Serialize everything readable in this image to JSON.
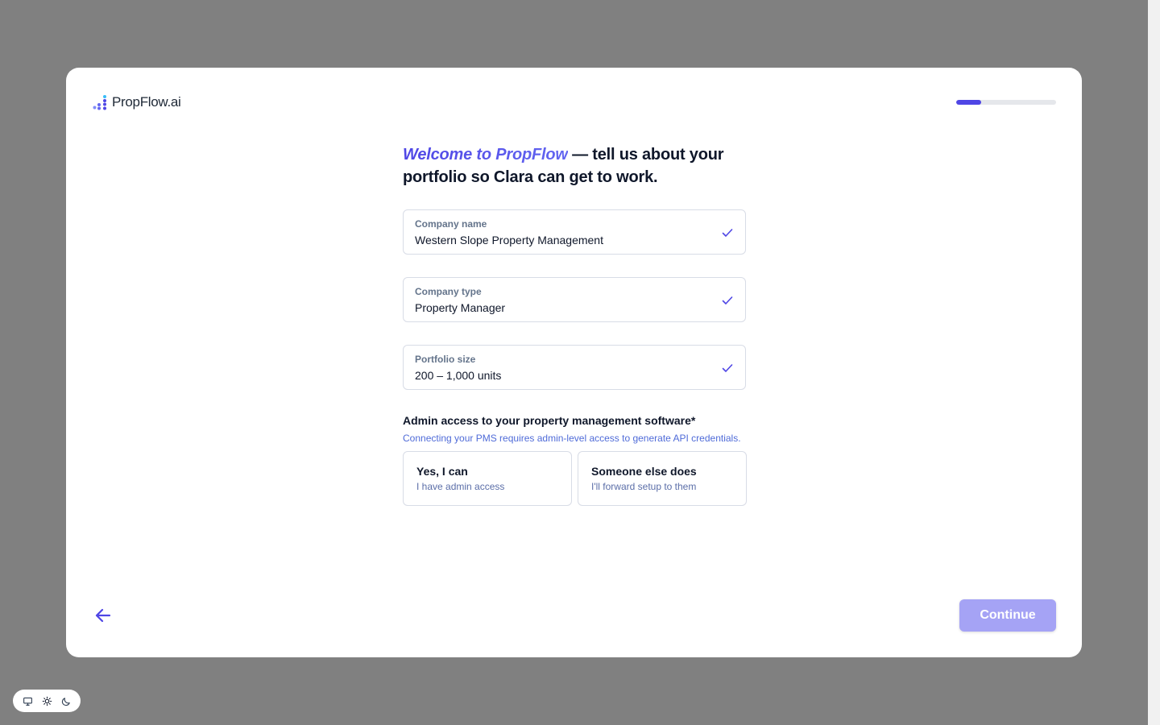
{
  "brand": {
    "name": "PropFlow.ai"
  },
  "progress": {
    "value_percent": 25
  },
  "headline": {
    "accent": "Welcome to PropFlow",
    "rest": " — tell us about your portfolio so Clara can get to work."
  },
  "fields": [
    {
      "label": "Company name",
      "value": "Western Slope Property Management"
    },
    {
      "label": "Company type",
      "value": "Property Manager"
    },
    {
      "label": "Portfolio size",
      "value": "200 – 1,000 units"
    }
  ],
  "admin_access": {
    "question": "Admin access to your property management software*",
    "help": "Connecting your PMS requires admin-level access to generate API credentials.",
    "options": [
      {
        "title": "Yes, I can",
        "subtitle": "I have admin access"
      },
      {
        "title": "Someone else does",
        "subtitle": "I'll forward setup to them"
      }
    ]
  },
  "footer": {
    "continue_label": "Continue"
  },
  "icons": {
    "check": "check-icon",
    "back": "arrow-left-icon",
    "theme": [
      "monitor-icon",
      "sun-icon",
      "moon-icon"
    ]
  },
  "colors": {
    "accent": "#4f46e5",
    "continue_disabled": "#a5a3f5",
    "overlay": "#808080"
  }
}
